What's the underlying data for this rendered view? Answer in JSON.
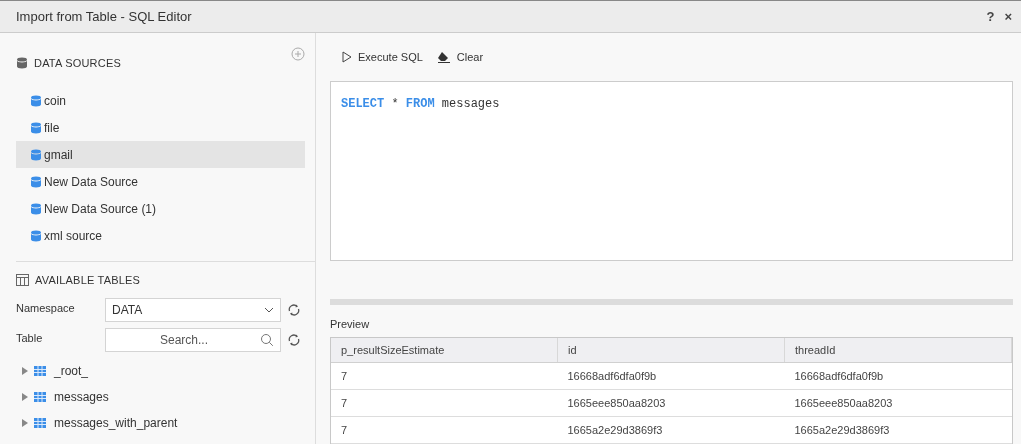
{
  "window": {
    "title": "Import from Table - SQL Editor",
    "help": "?",
    "close": "×"
  },
  "data_sources": {
    "heading": "DATA SOURCES",
    "items": [
      {
        "label": "coin",
        "selected": false
      },
      {
        "label": "file",
        "selected": false
      },
      {
        "label": "gmail",
        "selected": true
      },
      {
        "label": "New Data Source",
        "selected": false
      },
      {
        "label": "New Data Source (1)",
        "selected": false
      },
      {
        "label": "xml source",
        "selected": false
      }
    ]
  },
  "available_tables": {
    "heading": "AVAILABLE TABLES",
    "namespace_label": "Namespace",
    "namespace_value": "DATA",
    "table_label": "Table",
    "search_placeholder": "Search...",
    "tables": [
      {
        "label": "_root_",
        "expanded": false
      },
      {
        "label": "messages",
        "expanded": false
      },
      {
        "label": "messages_with_parent",
        "expanded": false
      }
    ]
  },
  "toolbar": [
    {
      "label": "Execute SQL",
      "kind": "run"
    },
    {
      "label": "Clear",
      "kind": "clear"
    }
  ],
  "query": [
    {
      "text": "SELECT",
      "kind": "keyword"
    },
    {
      "text": "*",
      "kind": "plain"
    },
    {
      "text": "FROM",
      "kind": "keyword"
    },
    {
      "text": "messages",
      "kind": "plain"
    }
  ],
  "preview": {
    "label": "Preview",
    "columns": [
      "p_resultSizeEstimate",
      "id",
      "threadId"
    ],
    "rows": [
      [
        "7",
        "16668adf6dfa0f9b",
        "16668adf6dfa0f9b"
      ],
      [
        "7",
        "1665eee850aa8203",
        "1665eee850aa8203"
      ],
      [
        "7",
        "1665a2e29d3869f3",
        "1665a2e29d3869f3"
      ]
    ]
  }
}
